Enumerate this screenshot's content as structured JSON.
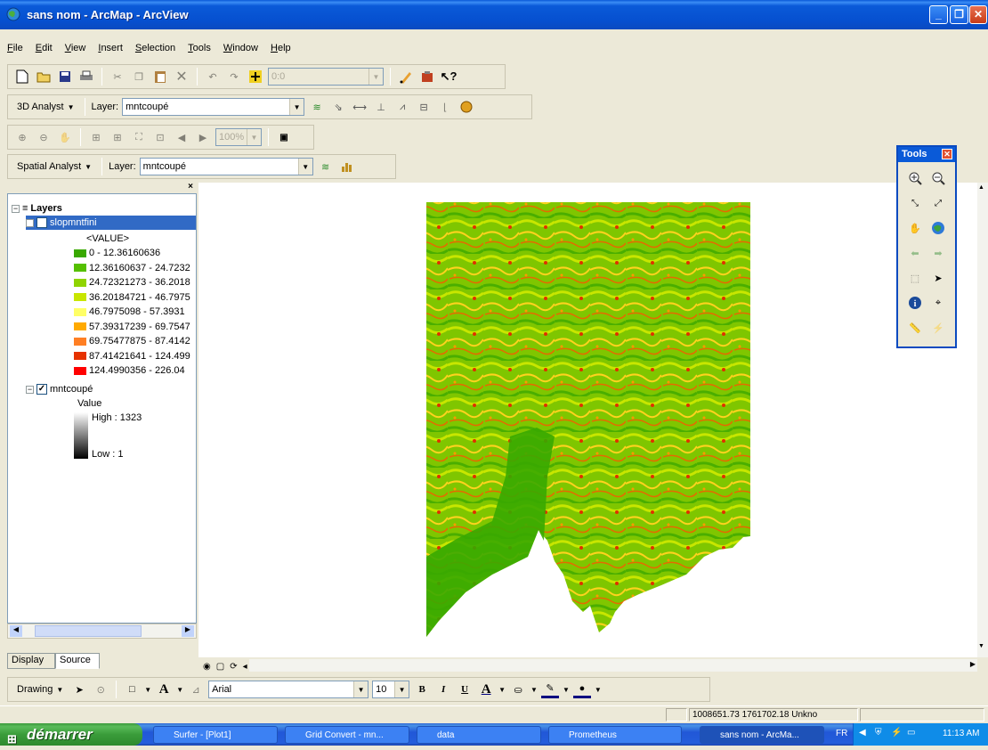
{
  "window": {
    "title": "sans nom - ArcMap - ArcView",
    "minimize": "_",
    "restore": "❐",
    "close": "✕"
  },
  "menu": [
    "File",
    "Edit",
    "View",
    "Insert",
    "Selection",
    "Tools",
    "Window",
    "Help"
  ],
  "standard_toolbar": {
    "scale_value": "0:0"
  },
  "analyst_3d_toolbar": {
    "menu_label": "3D Analyst",
    "layer_label": "Layer:",
    "layer_value": "mntcoupé"
  },
  "nav_toolbar": {
    "zoom_value": "100%"
  },
  "spatial_toolbar": {
    "menu_label": "Spatial Analyst",
    "layer_label": "Layer:",
    "layer_value": "mntcoupé"
  },
  "toc": {
    "root_label": "Layers",
    "layer1_name": "slopmntfini",
    "layer1_field": "<VALUE>",
    "classes": [
      {
        "label": "0 - 12.36160636",
        "color": "#38a800"
      },
      {
        "label": "12.36160637 - 24.7232",
        "color": "#55c000"
      },
      {
        "label": "24.72321273 - 36.2018",
        "color": "#8fd400"
      },
      {
        "label": "36.20184721 - 46.7975",
        "color": "#c8e600"
      },
      {
        "label": "46.7975098 - 57.3931",
        "color": "#ffff66"
      },
      {
        "label": "57.39317239 - 69.7547",
        "color": "#ffaa00"
      },
      {
        "label": "69.75477875 - 87.4142",
        "color": "#ff7f24"
      },
      {
        "label": "87.41421641 - 124.499",
        "color": "#e63200"
      },
      {
        "label": "124.4990356 - 226.04",
        "color": "#ff0000"
      }
    ],
    "layer2_name": "mntcoupé",
    "layer2_field": "Value",
    "high_label": "High : 1323",
    "low_label": "Low : 1"
  },
  "tabs": {
    "display": "Display",
    "source": "Source"
  },
  "tools_window": {
    "title": "Tools",
    "close": "✕"
  },
  "drawing_toolbar": {
    "menu_label": "Drawing",
    "font_name": "Arial",
    "font_size": "10",
    "bold": "B",
    "italic": "I",
    "underline": "U",
    "text_a": "A"
  },
  "status": {
    "coordinates": "1008651.73  1761702.18 Unkno"
  },
  "taskbar": {
    "start_label": "démarrer",
    "items": [
      "Surfer - [Plot1]",
      "Grid Convert - mn...",
      "data",
      "Prometheus",
      "sans nom - ArcMa..."
    ],
    "lang": "FR",
    "clock": "11:13 AM"
  }
}
